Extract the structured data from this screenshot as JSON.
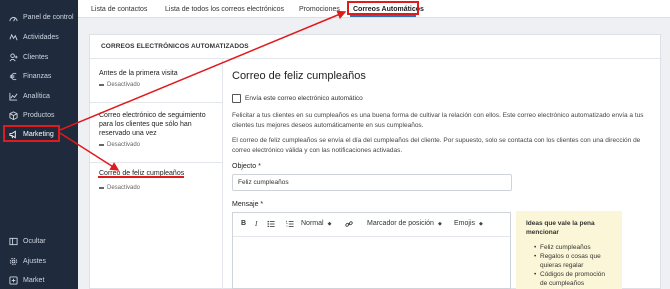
{
  "sidebar": {
    "items": [
      {
        "label": "Panel de control",
        "icon": "dashboard-icon"
      },
      {
        "label": "Actividades",
        "icon": "activity-icon"
      },
      {
        "label": "Clientes",
        "icon": "users-icon"
      },
      {
        "label": "Finanzas",
        "icon": "euro-icon"
      },
      {
        "label": "Analítica",
        "icon": "chart-icon"
      },
      {
        "label": "Productos",
        "icon": "box-icon"
      },
      {
        "label": "Marketing",
        "icon": "marketing-icon"
      }
    ],
    "bottom_items": [
      {
        "label": "Ocultar",
        "icon": "collapse-icon"
      },
      {
        "label": "Ajustes",
        "icon": "gear-icon"
      },
      {
        "label": "Market",
        "icon": "market-icon"
      }
    ]
  },
  "tabs": [
    "Lista de contactos",
    "Lista de todos los correos electrónicos",
    "Promociones",
    "Correos Automáticos"
  ],
  "panel": {
    "header": "CORREOS ELECTRÓNICOS AUTOMATIZADOS",
    "list": [
      {
        "title": "Antes de la primera visita",
        "status": "Desactivado"
      },
      {
        "title": "Correo electrónico de seguimiento para los clientes que sólo han reservado una vez",
        "status": "Desactivado"
      },
      {
        "title": "Correo de feliz cumpleaños",
        "status": "Desactivado"
      }
    ]
  },
  "detail": {
    "title": "Correo de feliz cumpleaños",
    "checkbox_label": "Envía este correo electrónico automático",
    "para1": "Felicitar a tus clientes en su cumpleaños es una buena forma de cultivar la relación con ellos. Este correo electrónico automatizado envía a tus clientes tus mejores deseos automáticamente en sus cumpleaños.",
    "para2": "El correo de feliz cumpleaños se envía el día del cumpleaños del cliente. Por supuesto, solo se contacta con los clientes con una dirección de correo electrónico válida y con las notificaciones activadas.",
    "subject_label": "Objecto *",
    "subject_value": "Feliz cumpleaños",
    "message_label": "Mensaje *",
    "toolbar": {
      "format": "Normal",
      "placeholder": "Marcador de posición",
      "emoji": "Emojis"
    }
  },
  "tips": {
    "title": "Ideas que vale la pena mencionar",
    "items": [
      "Feliz cumpleaños",
      "Regalos o cosas que quieras regalar",
      "Códigos de promoción de cumpleaños"
    ]
  },
  "colors": {
    "sidebar_bg": "#1f2a3c",
    "highlight": "#e01b1b",
    "tips_bg": "#fbf6d8"
  }
}
